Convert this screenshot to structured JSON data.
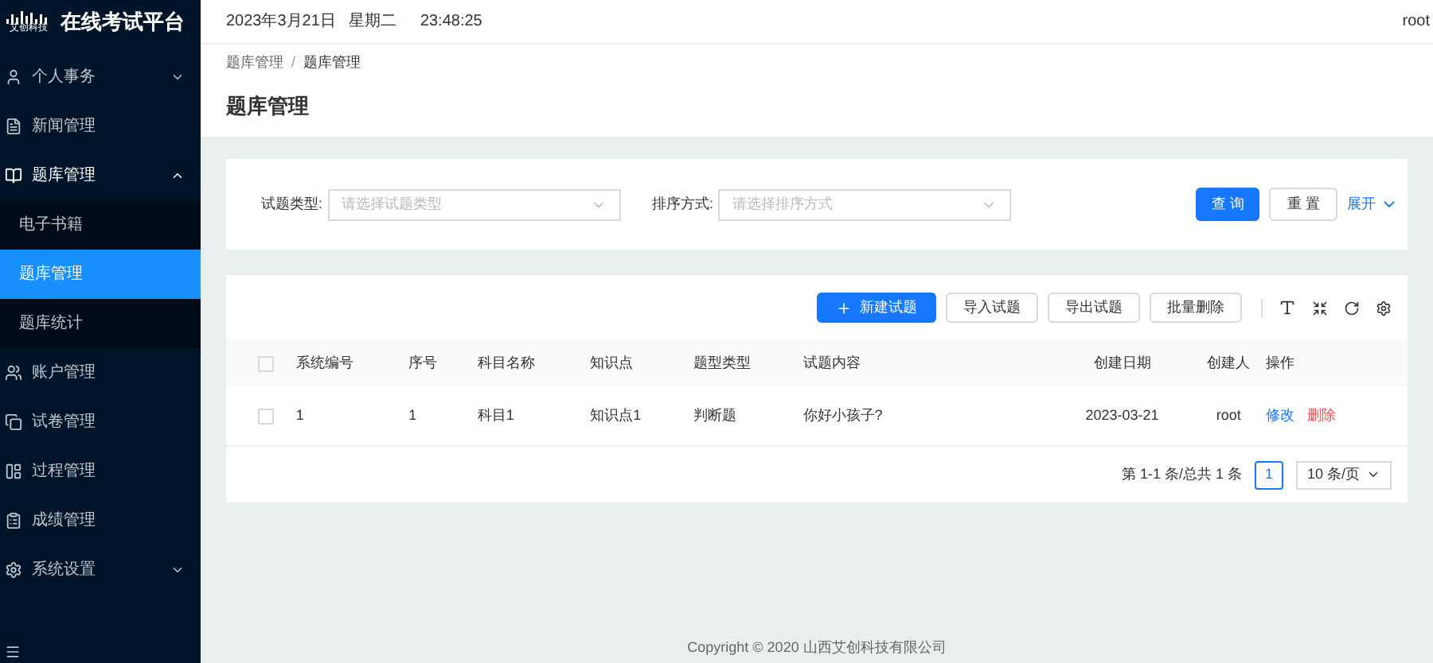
{
  "logo": {
    "mark_text": "艾创科技",
    "title": "在线考试平台"
  },
  "header": {
    "date": "2023年3月21日",
    "weekday": "星期二",
    "time": "23:48:25",
    "user": "root"
  },
  "sidebar": {
    "items": [
      {
        "label": "个人事务",
        "expanded": false,
        "has_arrow": true
      },
      {
        "label": "新闻管理",
        "expanded": false,
        "has_arrow": false
      },
      {
        "label": "题库管理",
        "expanded": true,
        "has_arrow": true,
        "children": [
          {
            "label": "电子书籍",
            "selected": false
          },
          {
            "label": "题库管理",
            "selected": true
          },
          {
            "label": "题库统计",
            "selected": false
          }
        ]
      },
      {
        "label": "账户管理",
        "expanded": false,
        "has_arrow": false
      },
      {
        "label": "试卷管理",
        "expanded": false,
        "has_arrow": false
      },
      {
        "label": "过程管理",
        "expanded": false,
        "has_arrow": false
      },
      {
        "label": "成绩管理",
        "expanded": false,
        "has_arrow": false
      },
      {
        "label": "系统设置",
        "expanded": false,
        "has_arrow": true
      }
    ]
  },
  "breadcrumb": {
    "separator": "/",
    "items": [
      "题库管理",
      "题库管理"
    ]
  },
  "page_title": "题库管理",
  "filters": [
    {
      "label": "试题类型:",
      "placeholder": "请选择试题类型"
    },
    {
      "label": "排序方式:",
      "placeholder": "请选择排序方式"
    }
  ],
  "filter_buttons": {
    "query": "查 询",
    "reset": "重 置",
    "expand": "展开"
  },
  "toolbar": {
    "buttons": [
      {
        "label": "新建试题",
        "kind": "primary"
      },
      {
        "label": "导入试题",
        "kind": "default"
      },
      {
        "label": "导出试题",
        "kind": "default"
      },
      {
        "label": "批量删除",
        "kind": "default"
      }
    ]
  },
  "table": {
    "header_checked": false,
    "columns": [
      "系统编号",
      "序号",
      "科目名称",
      "知识点",
      "题型类型",
      "试题内容",
      "创建日期",
      "创建人",
      "操作"
    ],
    "rows": [
      {
        "checked": false,
        "cells": [
          "1",
          "1",
          "科目1",
          "知识点1",
          "判断题",
          "你好小孩子?",
          "2023-03-21",
          "root"
        ],
        "actions": [
          "修改",
          "删除"
        ]
      }
    ]
  },
  "pagination": {
    "summary": "第 1-1 条/总共 1 条",
    "pages": [
      {
        "label": "1",
        "selected": true
      }
    ],
    "page_size": "10 条/页"
  },
  "footer": "Copyright © 2020 山西艾创科技有限公司"
}
